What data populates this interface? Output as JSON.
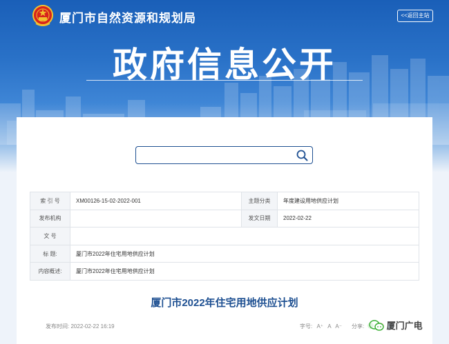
{
  "header": {
    "org_name": "厦门市自然资源和规划局",
    "back_label": "<<返回主站",
    "banner_title": "政府信息公开"
  },
  "search": {
    "value": "",
    "placeholder": ""
  },
  "meta_table": {
    "rows": [
      {
        "label": "索 引 号",
        "value": "XM00126-15-02-2022-001",
        "label2": "主题分类",
        "value2": "年度建设用地供应计划"
      },
      {
        "label": "发布机构",
        "value": "",
        "label2": "发文日期",
        "value2": "2022-02-22"
      },
      {
        "label": "文    号",
        "value": ""
      },
      {
        "label": "标    题:",
        "value": "厦门市2022年住宅用地供应计划"
      },
      {
        "label": "内容概述:",
        "value": "厦门市2022年住宅用地供应计划"
      }
    ]
  },
  "document": {
    "title": "厦门市2022年住宅用地供应计划",
    "publish_label": "发布时间:",
    "publish_time": "2022-02-22 16:19",
    "font_size_label": "字号:",
    "font_sizes": [
      "A⁺",
      "A",
      "A⁻"
    ],
    "share_label": "分享:"
  },
  "watermark": {
    "text": "厦门广电"
  },
  "colors": {
    "brand_blue": "#1d4f91",
    "hero_blue": "#1a5fb8",
    "share_green": "#3cb035",
    "share_red": "#e0443a",
    "share_blue": "#2a8fe0"
  }
}
